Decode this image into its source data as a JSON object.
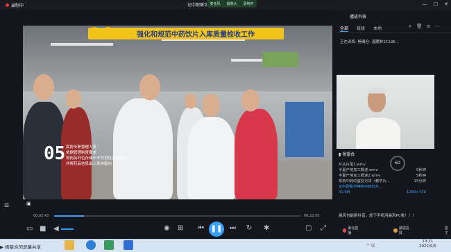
{
  "window": {
    "recording_label": "录制中",
    "title": "记中耐贩字带的中药饮片",
    "float_items": [
      "麦克风",
      "摄像头",
      "录制中"
    ],
    "controls": [
      "—",
      "□",
      "✕"
    ]
  },
  "video": {
    "headline": "强化和规范中药饮片入库质量检收工作",
    "sign_text": "",
    "caption_number": "05",
    "caption_lines": [
      "库房专职管理人员",
      "依据管理制度要求",
      "将药品归位存储于不同货位区域备用",
      "并将药品信息录入系统备用"
    ],
    "time_current": "00:02:42",
    "time_total": "00:22:50",
    "progress_fraction": 0.12,
    "volume_fraction": 0.6
  },
  "panel": {
    "title": "播放列表",
    "tabs": [
      "全部",
      "链接",
      "本地"
    ],
    "active_tab": "全部",
    "now_playing": "正在训练: 畅曦仓: 温鹏林11195...",
    "speaker_name": "杨锟合",
    "progress_badge": "60",
    "playlist": [
      {
        "name": "片头片尾2.wmv",
        "dur": "",
        "active": false
      },
      {
        "name": "半夏产地加工概述.wmv",
        "dur": "5秒钟",
        "active": false
      },
      {
        "name": "半夏产地加工概述2.wmv",
        "dur": "5秒钟",
        "active": false
      },
      {
        "name": "常用中药的鉴别方法（教学片...",
        "dur": "15分钟",
        "active": false
      },
      {
        "name": "记中耐贩字带的中药饮片...",
        "dur": "",
        "active": true
      }
    ],
    "active_meta": [
      "31.6M",
      "1280×720"
    ],
    "comment": "晨风也能刷抖音，放下手机用晨风PC看！！！",
    "chat_actions": [
      "美化直播",
      "晨镜投屏",
      "盒子"
    ]
  },
  "taskbar": {
    "share_label": "杨锟合的屏幕共享",
    "tray_text": "^ 中",
    "time": "13:21",
    "date": "2022/9/5"
  }
}
